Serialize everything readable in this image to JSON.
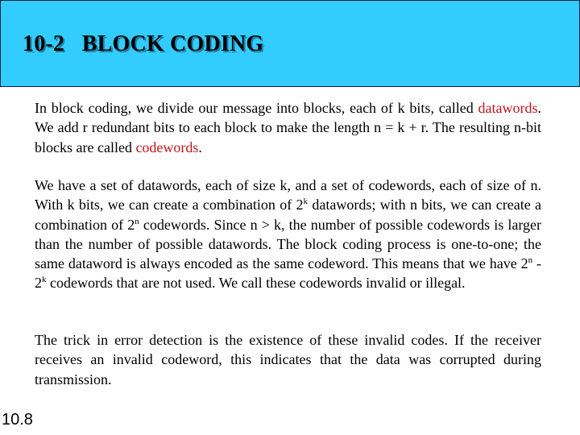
{
  "header": {
    "title": "10-2   BLOCK CODING",
    "background_color": "#33ccff"
  },
  "paragraphs": {
    "p1": {
      "a": "In block coding, we divide our message into blocks, each of k bits, called ",
      "term1": "datawords",
      "b": ". We add r redundant bits to each block to make the length n = k + r. The resulting n-bit blocks are called ",
      "term2": "codewords",
      "c": "."
    },
    "p2": {
      "a": "We have a set of datawords, each of size k, and a set of codewords, each of size of n. With k bits, we can create a combination of 2",
      "sup1": "k",
      "b": " datawords; with n bits, we can create a combination of 2",
      "sup2": "n",
      "c": " codewords. Since n > k, the number of possible codewords is larger than the number of possible datawords. The block coding process is one-to-one; the same dataword is always encoded as the same codeword. This means that we have 2",
      "sup3": "n",
      "d": " - 2",
      "sup4": "k",
      "e": " codewords that are not used. We call these codewords invalid or illegal."
    },
    "p3": "The trick in error detection is the existence of these invalid codes. If the receiver receives an invalid codeword, this indicates that the data was corrupted during transmission."
  },
  "highlight_color": "#c0141c",
  "page_number": "10.8"
}
